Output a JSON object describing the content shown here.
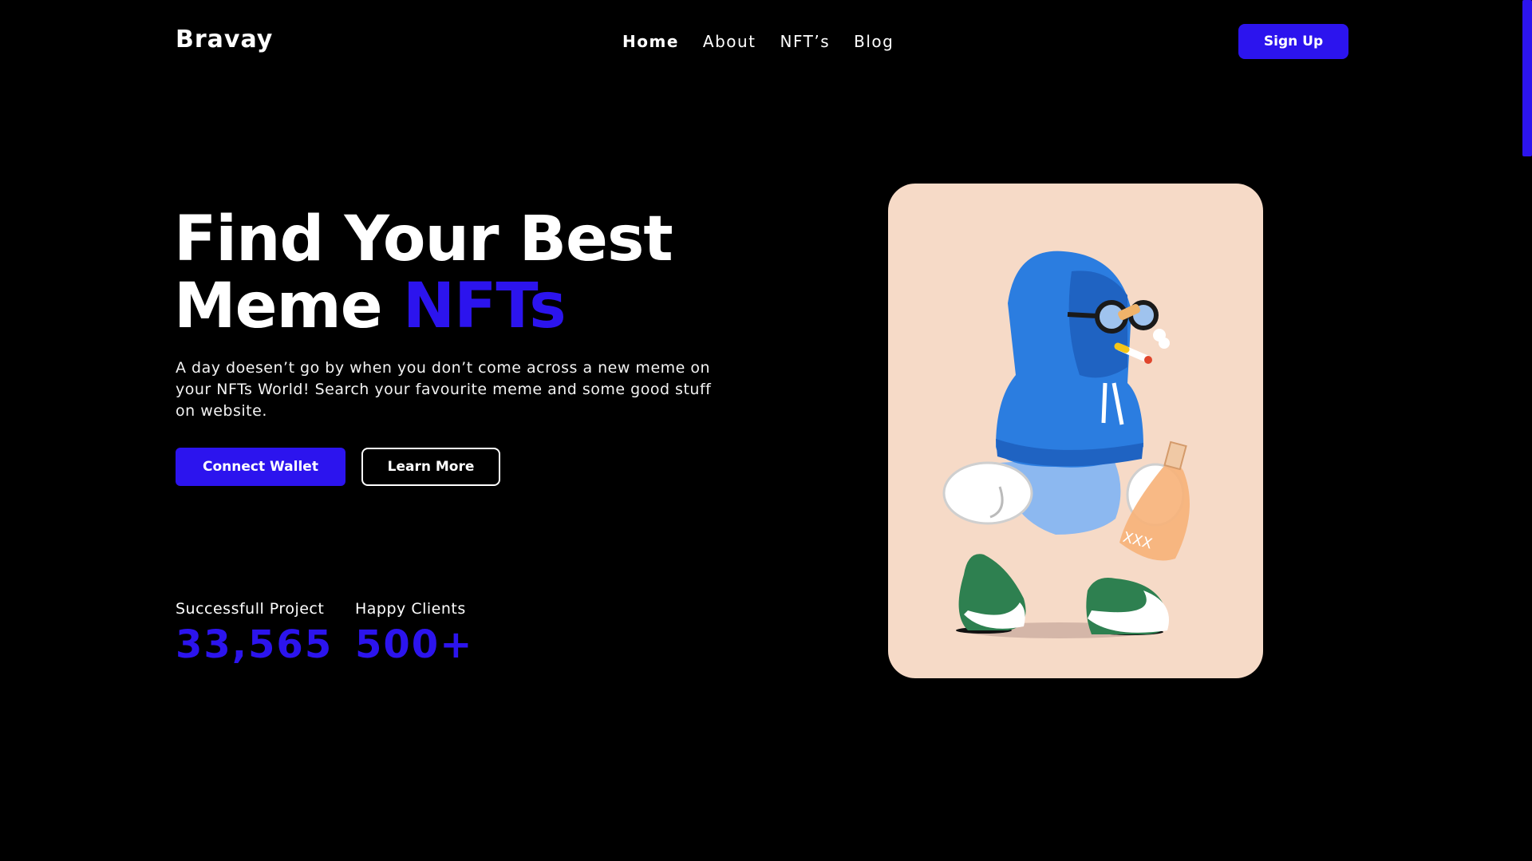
{
  "header": {
    "logo": "Bravay",
    "nav": [
      "Home",
      "About",
      "NFT’s",
      "Blog"
    ],
    "active_nav": "Home",
    "signup_label": "Sign Up"
  },
  "hero": {
    "title_line1": "Find Your Best",
    "title_line2_plain": "Meme ",
    "title_line2_accent": "NFTs",
    "description": "A day doesen’t go by when you don’t come across a new meme on your NFTs World! Search your favourite meme and some good stuff on website.",
    "primary_button": "Connect Wallet",
    "secondary_button": "Learn More"
  },
  "stats": [
    {
      "label": "Successfull Project",
      "value": "33,565"
    },
    {
      "label": "Happy Clients",
      "value": "500+"
    }
  ],
  "colors": {
    "accent": "#2c14ee",
    "background": "#000000",
    "card_bg": "#f6dac7"
  },
  "illustration": {
    "bottle_text": "XXX"
  }
}
